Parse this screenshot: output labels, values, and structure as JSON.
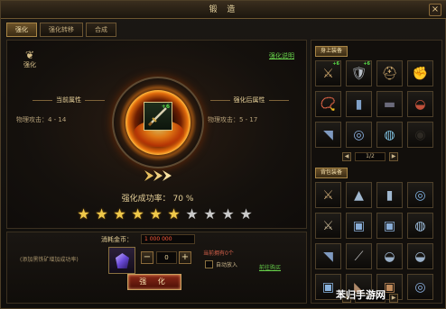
{
  "window": {
    "title": "锻 造",
    "close_label": "×"
  },
  "tabs": [
    {
      "label": "强化",
      "active": true
    },
    {
      "label": "强化转移",
      "active": false
    },
    {
      "label": "合成",
      "active": false
    }
  ],
  "main": {
    "emblem_label": "强化",
    "help_link": "强化说明",
    "current": {
      "title": "当前属性",
      "attr": "物理攻击：4 - 14"
    },
    "after": {
      "title": "强化后属性",
      "attr": "物理攻击：5 - 17"
    },
    "item_level": "+6",
    "success_rate_label": "强化成功率：",
    "success_rate_value": "70 %",
    "stars_total": 10,
    "stars_filled": 6
  },
  "bottom": {
    "fee_label": "消耗金币：",
    "fee_value": "1 000 000",
    "hint": "(添加黑铁矿增加成功率)",
    "quantity": "0",
    "minus_label": "−",
    "plus_label": "+",
    "owned": "当前拥有0个",
    "auto_label": "自动放入",
    "buy_link": "前往购买",
    "button_label": "强 化"
  },
  "side": {
    "equipped_title": "身上装备",
    "equipped_page": "1/2",
    "bag_title": "背包装备",
    "bag_page": "1/5",
    "prev_label": "◀",
    "next_label": "▶",
    "equipped_items": [
      {
        "icon": "sword-icon",
        "glyph": "⚔",
        "color": "#c9a36a",
        "lv": "+6"
      },
      {
        "icon": "armor-icon",
        "glyph": "🛡",
        "color": "#b9c0c8",
        "lv": "+6"
      },
      {
        "icon": "helmet-icon",
        "glyph": "⛑",
        "color": "#c8a46a",
        "lv": ""
      },
      {
        "icon": "gloves-icon",
        "glyph": "✊",
        "color": "#c0402f",
        "lv": ""
      },
      {
        "icon": "necklace-icon",
        "glyph": "📿",
        "color": "#9a8a70",
        "lv": ""
      },
      {
        "icon": "bracer-icon",
        "glyph": "▮",
        "color": "#7fa0c8",
        "lv": ""
      },
      {
        "icon": "boots-icon",
        "glyph": "▬",
        "color": "#6a6a7a",
        "lv": ""
      },
      {
        "icon": "belt-icon",
        "glyph": "◒",
        "color": "#c0503a",
        "lv": ""
      },
      {
        "icon": "leggings-icon",
        "glyph": "◥",
        "color": "#7f9ac0",
        "lv": ""
      },
      {
        "icon": "ring-icon",
        "glyph": "◎",
        "color": "#8ab0e0",
        "lv": ""
      },
      {
        "icon": "ring-icon",
        "glyph": "◍",
        "color": "#7fc0e0",
        "lv": ""
      },
      {
        "icon": "empty-slot",
        "glyph": "◉",
        "color": "#2e2a24",
        "lv": ""
      }
    ],
    "bag_items": [
      {
        "icon": "sword-icon",
        "glyph": "⚔",
        "color": "#c0a070",
        "lv": ""
      },
      {
        "icon": "helmet-icon",
        "glyph": "▲",
        "color": "#a0b8d0",
        "lv": ""
      },
      {
        "icon": "leggings-icon",
        "glyph": "▮",
        "color": "#a0b8d0",
        "lv": ""
      },
      {
        "icon": "ring-icon",
        "glyph": "◎",
        "color": "#7fb0e0",
        "lv": ""
      },
      {
        "icon": "blade-icon",
        "glyph": "⚔",
        "color": "#c0b090",
        "lv": ""
      },
      {
        "icon": "armor-icon",
        "glyph": "▣",
        "color": "#8aaed8",
        "lv": ""
      },
      {
        "icon": "armor-icon",
        "glyph": "▣",
        "color": "#8aaed8",
        "lv": ""
      },
      {
        "icon": "bracelet-icon",
        "glyph": "◍",
        "color": "#a0c0e0",
        "lv": ""
      },
      {
        "icon": "leggings-icon",
        "glyph": "◥",
        "color": "#7f9ac0",
        "lv": ""
      },
      {
        "icon": "spear-icon",
        "glyph": "⟋",
        "color": "#b8b8b8",
        "lv": ""
      },
      {
        "icon": "belt-icon",
        "glyph": "◒",
        "color": "#9ab0c8",
        "lv": ""
      },
      {
        "icon": "belt-icon",
        "glyph": "◒",
        "color": "#9ab0c8",
        "lv": ""
      },
      {
        "icon": "armor-icon",
        "glyph": "▣",
        "color": "#8ab4e0",
        "lv": ""
      },
      {
        "icon": "boots-icon",
        "glyph": "◣",
        "color": "#b08a6a",
        "lv": ""
      },
      {
        "icon": "armor-icon",
        "glyph": "▣",
        "color": "#c08a5a",
        "lv": ""
      },
      {
        "icon": "ring-icon",
        "glyph": "◎",
        "color": "#8ab0e0",
        "lv": ""
      }
    ]
  },
  "watermark": "苯归手游网"
}
